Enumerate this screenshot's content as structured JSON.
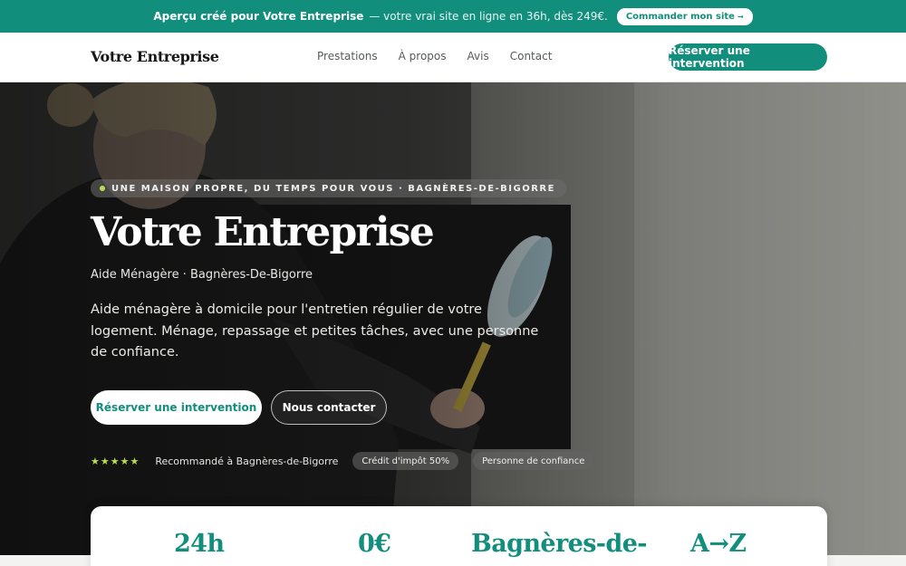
{
  "banner": {
    "strong": "Aperçu créé pour Votre Entreprise",
    "text": "— votre vrai site en ligne en 36h, dès 249€.",
    "cta_label": "Commander mon site",
    "cta_arrow": "→"
  },
  "header": {
    "logo": "Votre Entreprise",
    "nav": [
      "Prestations",
      "À propos",
      "Avis",
      "Contact"
    ],
    "book_label": "Réserver une intervention"
  },
  "hero": {
    "eyebrow": "UNE MAISON PROPRE, DU TEMPS POUR VOUS · BAGNÈRES-DE-BIGORRE",
    "title": "Votre Entreprise",
    "subtitle": "Aide Ménagère · Bagnères-De-Bigorre",
    "lead": "Aide ménagère à domicile pour l'entretien régulier de votre logement. Ménage, repassage et petites tâches, avec une personne de confiance.",
    "primary_label": "Réserver une intervention",
    "secondary_label": "Nous contacter",
    "stars": "★★★★★",
    "recommended": "Recommandé à Bagnères-de-Bigorre",
    "pills": [
      "Crédit d'impôt 50%",
      "Personne de confiance"
    ]
  },
  "stats": [
    "24h",
    "0€",
    "Bagnères-de-",
    "A→Z"
  ],
  "colors": {
    "accent": "#128e7d",
    "highlight": "#b7df52"
  }
}
